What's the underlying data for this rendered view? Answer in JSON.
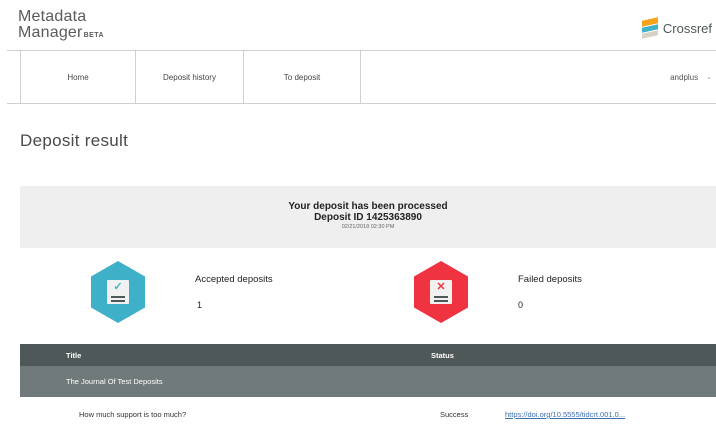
{
  "header": {
    "logo_line1": "Metadata",
    "logo_line2": "Manager",
    "logo_badge": "BETA",
    "brand_name": "Crossref",
    "brand_colors": [
      "#f7a21b",
      "#3eb1c8",
      "#d8d2c4"
    ]
  },
  "nav": {
    "items": [
      {
        "label": "Home"
      },
      {
        "label": "Deposit history"
      },
      {
        "label": "To deposit"
      }
    ],
    "user": "andplus"
  },
  "page": {
    "title": "Deposit result"
  },
  "summary": {
    "message": "Your deposit has been processed",
    "deposit_id": "Deposit ID 1425363890",
    "timestamp": "02/21/2018 02:30 PM"
  },
  "stats": {
    "accepted": {
      "label": "Accepted deposits",
      "count": "1",
      "icon": "checkmark-doc-icon",
      "color": "#3eb1c8"
    },
    "failed": {
      "label": "Failed deposits",
      "count": "0",
      "icon": "x-doc-icon",
      "color": "#ef3340"
    }
  },
  "table": {
    "columns": [
      "Title",
      "Status"
    ],
    "group": "The Journal Of Test Deposits",
    "rows": [
      {
        "title": "How much support is too much?",
        "status": "Success",
        "link": "https://doi.org/10.5555/tidcrt.001.0..."
      }
    ]
  }
}
